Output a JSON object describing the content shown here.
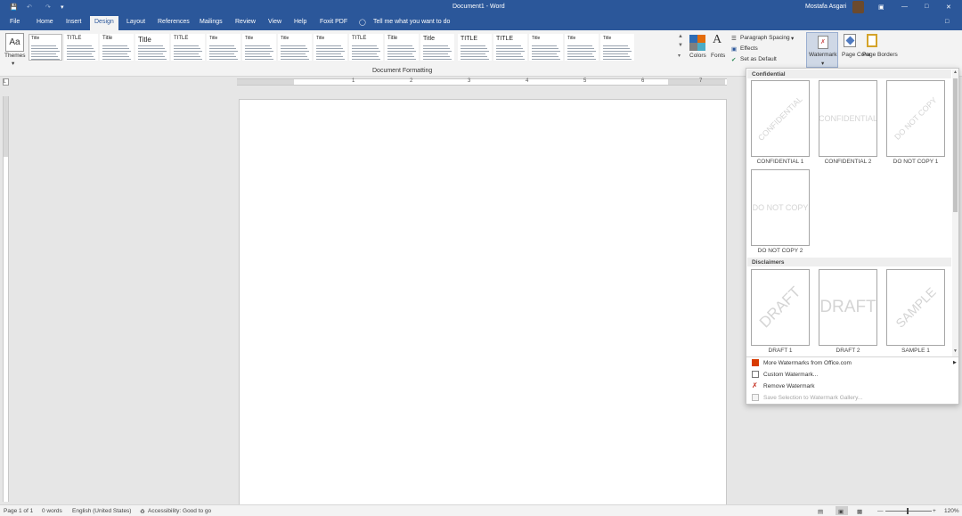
{
  "window": {
    "title": "Document1  -  Word",
    "user_name": "Mostafa Asgari"
  },
  "tabs": [
    "File",
    "Home",
    "Insert",
    "Design",
    "Layout",
    "References",
    "Mailings",
    "Review",
    "View",
    "Help",
    "Foxit PDF"
  ],
  "active_tab": "Design",
  "tell_me": "Tell me what you want to do",
  "ribbon": {
    "themes_label": "Themes",
    "document_formatting_label": "Document Formatting",
    "style_sets": [
      "Title",
      "TITLE",
      "Title",
      "Title",
      "TITLE",
      "Title",
      "Title",
      "Title",
      "Title",
      "TITLE",
      "Title",
      "Title",
      "TITLE",
      "TITLE",
      "Title",
      "Title",
      "Title"
    ],
    "colors_label": "Colors",
    "fonts_label": "Fonts",
    "paragraph_spacing_label": "Paragraph Spacing",
    "effects_label": "Effects",
    "set_as_default_label": "Set as Default",
    "watermark_label": "Watermark",
    "page_color_label": "Page Color",
    "page_borders_label": "Page Borders"
  },
  "ruler_numbers": [
    "1",
    "2",
    "3",
    "4",
    "5",
    "6",
    "7"
  ],
  "watermark_menu": {
    "sections": [
      {
        "title": "Confidential",
        "items": [
          {
            "caption": "CONFIDENTIAL 1",
            "text": "CONFIDENTIAL"
          },
          {
            "caption": "CONFIDENTIAL 2",
            "text": "CONFIDENTIAL"
          },
          {
            "caption": "DO NOT COPY 1",
            "text": "DO NOT COPY"
          },
          {
            "caption": "DO NOT COPY 2",
            "text": "DO NOT COPY"
          }
        ]
      },
      {
        "title": "Disclaimers",
        "items": [
          {
            "caption": "DRAFT 1",
            "text": "DRAFT"
          },
          {
            "caption": "DRAFT 2",
            "text": "DRAFT"
          },
          {
            "caption": "SAMPLE 1",
            "text": "SAMPLE"
          }
        ]
      }
    ],
    "commands": [
      {
        "label": "More Watermarks from Office.com",
        "disabled": false,
        "icon": "office-icon"
      },
      {
        "label": "Custom Watermark...",
        "disabled": false,
        "icon": "document-icon"
      },
      {
        "label": "Remove Watermark",
        "disabled": false,
        "icon": "remove-icon"
      },
      {
        "label": "Save Selection to Watermark Gallery...",
        "disabled": true,
        "icon": "gallery-icon"
      }
    ]
  },
  "status": {
    "page": "Page 1 of 1",
    "words": "0 words",
    "language": "English (United States)",
    "accessibility": "Accessibility: Good to go",
    "zoom": "120%"
  },
  "colors": {
    "brand": "#2b579a",
    "ribbon_bg": "#f3f3f3",
    "app_bg": "#e6e6e6"
  }
}
